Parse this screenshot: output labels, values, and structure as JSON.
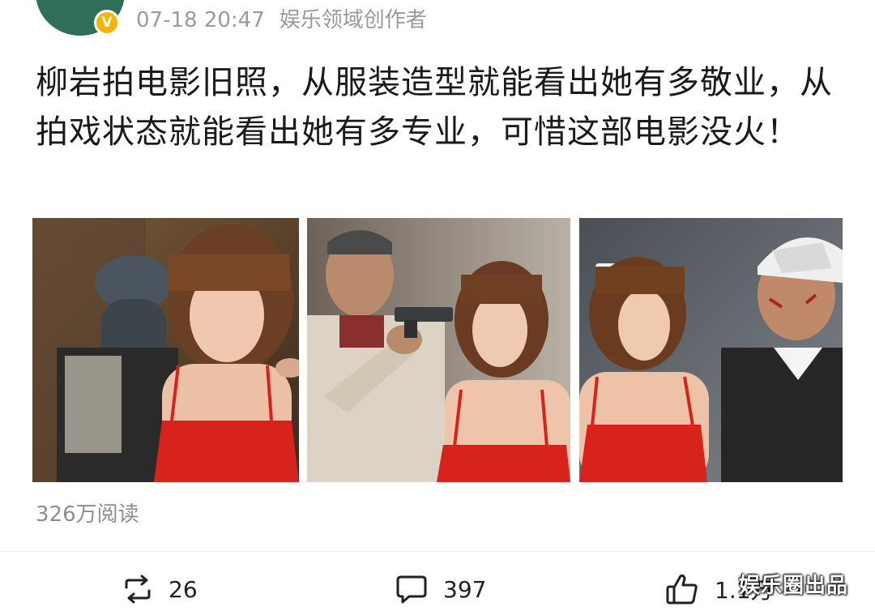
{
  "post": {
    "timestamp": "07-18 20:47",
    "source": "娱乐领域创作者",
    "verified_badge": "V",
    "text": "柳岩拍电影旧照，从服装造型就能看出她有多敬业，从拍戏状态就能看出她有多专业，可惜这部电影没火！",
    "reads": "326万阅读"
  },
  "actions": {
    "repost_count": "26",
    "comment_count": "397",
    "like_count": "1.1万"
  },
  "watermark": "娱乐圈出品",
  "icons": [
    "repost-icon",
    "comment-icon",
    "like-icon"
  ],
  "colors": {
    "dress_red": "#d8231d",
    "badge": "#f5b500",
    "avatar": "#2f6f5a"
  }
}
